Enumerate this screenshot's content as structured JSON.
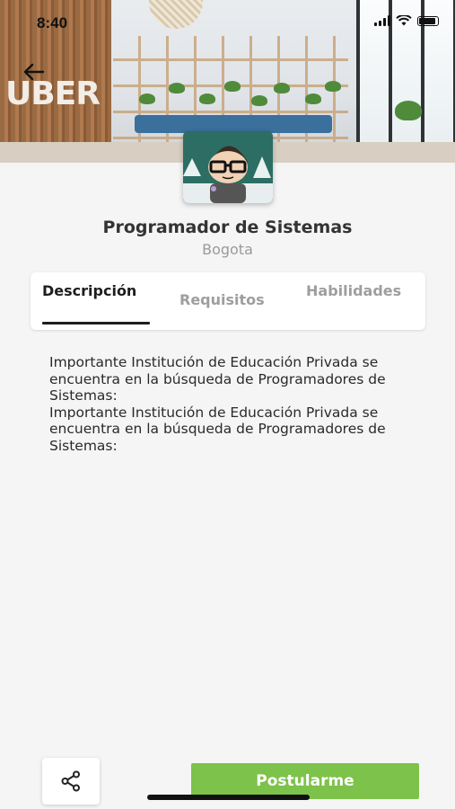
{
  "status_bar": {
    "time": "8:40"
  },
  "header": {
    "back_icon": "arrow-left-icon",
    "brand_sign": "UBER"
  },
  "job": {
    "title": "Programador de Sistemas",
    "location": "Bogota"
  },
  "tabs": [
    {
      "label": "Descripción",
      "active": true
    },
    {
      "label": "Requisitos",
      "active": false
    },
    {
      "label": "Habilidades",
      "active": false
    }
  ],
  "description": {
    "lines": [
      "Importante Institución de Educación Privada se encuentra en la búsqueda de Programadores de Sistemas:",
      "Importante Institución de Educación Privada se encuentra en la búsqueda de Programadores de Sistemas:"
    ]
  },
  "actions": {
    "share_icon": "share-icon",
    "apply_label": "Postularme"
  },
  "colors": {
    "accent_green": "#7dc24a",
    "background": "#f5f5f6",
    "tab_active": "#1e1e1e",
    "tab_inactive": "#9e9e9e"
  }
}
